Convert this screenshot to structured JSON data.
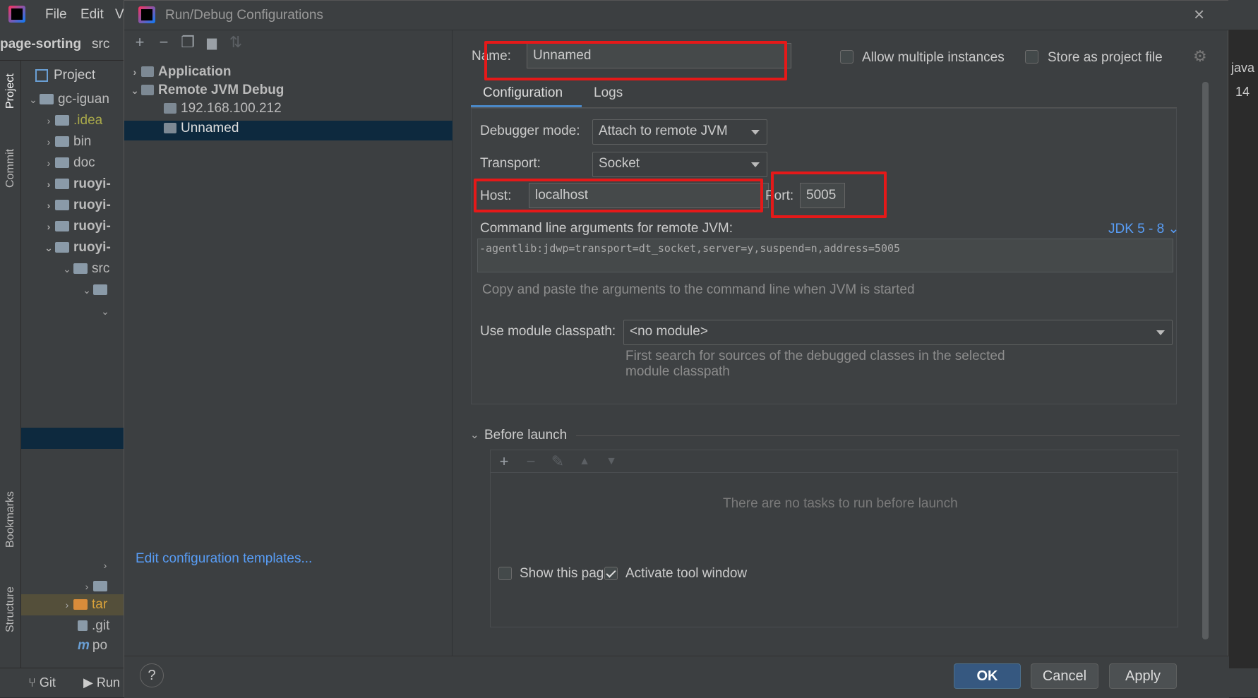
{
  "ide": {
    "menu": [
      "File",
      "Edit",
      "V"
    ],
    "breadcrumb": [
      "page-sorting",
      "src"
    ],
    "project_label": "Project",
    "root_label": "gc-iguan",
    "tree": [
      ".idea",
      "bin",
      "doc",
      "ruoyi-",
      "ruoyi-",
      "ruoyi-",
      "ruoyi-",
      "src",
      "",
      "",
      "",
      "",
      "tar",
      ".git",
      "po"
    ],
    "side_tabs": [
      "Project",
      "Commit",
      "Bookmarks",
      "Structure"
    ],
    "bottom_tabs": [
      "Git",
      "Run"
    ],
    "right_snips": [
      "java",
      "14"
    ]
  },
  "dialog": {
    "title": "Run/Debug Configurations",
    "tree": {
      "application": "Application",
      "remote": "Remote JVM Debug",
      "item1": "192.168.100.212",
      "item2": "Unnamed"
    },
    "edit_templates": "Edit configuration templates...",
    "name_label": "Name:",
    "name_value": "Unnamed",
    "allow_multiple": "Allow multiple instances",
    "store_as_file": "Store as project file",
    "tabs": [
      "Configuration",
      "Logs"
    ],
    "debugger_mode_label": "Debugger mode:",
    "debugger_mode_value": "Attach to remote JVM",
    "transport_label": "Transport:",
    "transport_value": "Socket",
    "host_label": "Host:",
    "host_value": "localhost",
    "port_label": "Port:",
    "port_value": "5005",
    "cmd_label": "Command line arguments for remote JVM:",
    "jdk_link": "JDK 5 - 8",
    "cmd_value": "-agentlib:jdwp=transport=dt_socket,server=y,suspend=n,address=5005",
    "cmd_hint": "Copy and paste the arguments to the command line when JVM is started",
    "module_label": "Use module classpath:",
    "module_value": "<no module>",
    "module_hint_1": "First search for sources of the debugged classes in the selected",
    "module_hint_2": "module classpath",
    "before_launch": "Before launch",
    "no_tasks": "There are no tasks to run before launch",
    "show_page": "Show this page",
    "activate_tool": "Activate tool window",
    "ok": "OK",
    "cancel": "Cancel",
    "apply": "Apply",
    "help": "?"
  },
  "colors": {
    "accent": "#365880",
    "link": "#589df6",
    "highlight": "#e51919",
    "selection": "#0d293e"
  }
}
